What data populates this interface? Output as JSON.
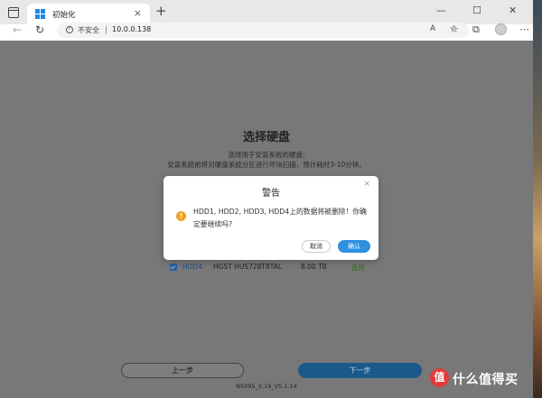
{
  "browser": {
    "tab_title": "初始化",
    "tab_close": "×",
    "new_tab": "+",
    "insecure_label": "不安全",
    "url": "10.0.0.138",
    "win_min": "—",
    "win_max": "☐",
    "win_close": "✕"
  },
  "page": {
    "title": "选择硬盘",
    "description_line1": "选择用于安装系统的硬盘;",
    "description_line2": "安装系统前将对硬盘系统分区进行坏块扫描，预计耗时3-10分钟。",
    "disk_row": {
      "name": "HDD4",
      "model": "HGST HUS728T8TAL",
      "size": "8.00 TB",
      "status": "良好",
      "checked": true
    },
    "prev_button": "上一步",
    "next_button": "下一步",
    "version": "N5095_5.19_V5.1.14"
  },
  "modal": {
    "title": "警告",
    "close": "×",
    "message_line1": "HDD1, HDD2, HDD3, HDD4上的数据将被删除！你确",
    "message_line2": "定要继续吗?",
    "cancel_button": "取消",
    "confirm_button": "确认"
  },
  "watermark": {
    "logo": "值",
    "text": "什么值得买"
  },
  "colors": {
    "accent": "#2f8fe0",
    "warning": "#f0a020",
    "overlay": "#787878"
  }
}
